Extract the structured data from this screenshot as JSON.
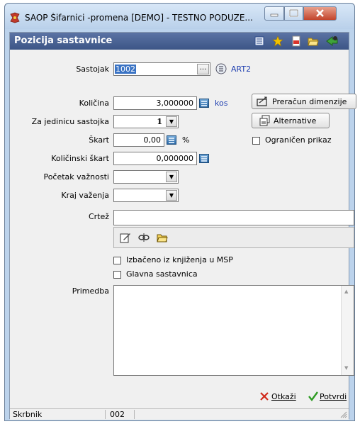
{
  "window": {
    "title": "SAOP Šifarnici -promena [DEMO] - TESTNO PODUZE..."
  },
  "header": {
    "title": "Pozicija sastavnice"
  },
  "form": {
    "sastojak": {
      "label": "Sastojak",
      "value": "1002",
      "code": "ART2"
    },
    "kolicina": {
      "label": "Količina",
      "value": "3,000000",
      "unit": "kos"
    },
    "za_jedinicu": {
      "label": "Za jedinicu sastojka",
      "value": "1"
    },
    "skart": {
      "label": "Škart",
      "value": "0,00",
      "unit": "%"
    },
    "kolicinski_skart": {
      "label": "Količinski škart",
      "value": "0,000000"
    },
    "pocetak": {
      "label": "Početak važnosti",
      "value": ""
    },
    "kraj": {
      "label": "Kraj važenja",
      "value": ""
    },
    "crtez": {
      "label": "Crtež",
      "value": ""
    },
    "primedba": {
      "label": "Primedba",
      "value": ""
    },
    "izbaceno": {
      "label": "Izbačeno iz knjiženja u MSP",
      "checked": false
    },
    "glavna": {
      "label": "Glavna sastavnica",
      "checked": false
    }
  },
  "buttons": {
    "preracun": "Preračun dimenzije",
    "alternative": "Alternative",
    "ogranicen": "Ograničen prikaz",
    "otkazi": "Otkaži",
    "potvrdi": "Potvrdi"
  },
  "status": {
    "skrbnik_label": "Skrbnik",
    "skrbnik_value": "002"
  },
  "colors": {
    "header": "#46609a",
    "accent_link": "#1f3fb0",
    "close_button": "#c2442c"
  }
}
